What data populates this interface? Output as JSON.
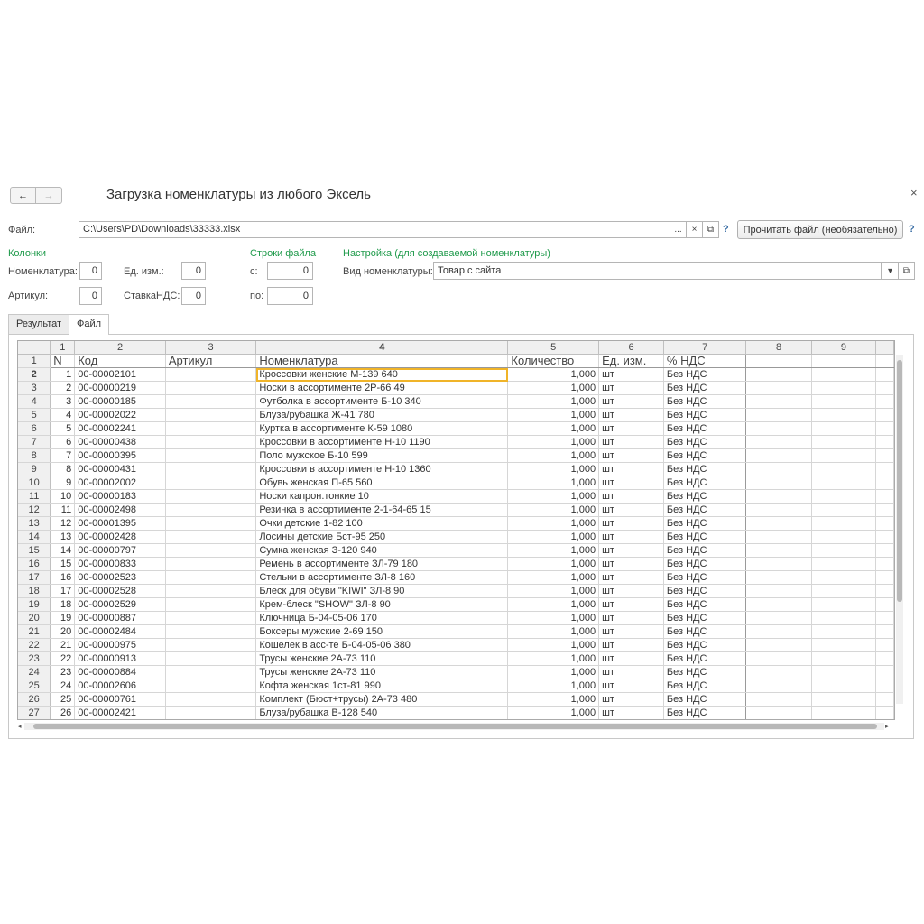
{
  "window": {
    "title": "Загрузка номенклатуры из любого Эксель",
    "back": "←",
    "forward": "→",
    "close": "×"
  },
  "file": {
    "label": "Файл:",
    "path": "C:\\Users\\PD\\Downloads\\33333.xlsx",
    "select_btn": "...",
    "clear_btn": "×",
    "open_btn": "⧉",
    "help": "?",
    "read_btn": "Прочитать файл (необязательно)",
    "read_help": "?"
  },
  "columns": {
    "section": "Колонки",
    "nomenclature_label": "Номенклатура:",
    "nomenclature_value": "0",
    "unit_label": "Ед. изм.:",
    "unit_value": "0",
    "article_label": "Артикул:",
    "article_value": "0",
    "vat_label": "СтавкаНДС:",
    "vat_value": "0"
  },
  "file_rows": {
    "section": "Строки файла",
    "from_label": "с:",
    "from_value": "0",
    "to_label": "по:",
    "to_value": "0"
  },
  "settings": {
    "section": "Настройка (для создаваемой номенклатуры)",
    "kind_label": "Вид номенклатуры:",
    "kind_value": "Товар с сайта",
    "dropdown": "▾",
    "open": "⧉"
  },
  "tabs": [
    {
      "label": "Результат"
    },
    {
      "label": "Файл"
    }
  ],
  "sheet": {
    "col_numbers": [
      "1",
      "2",
      "3",
      "4",
      "5",
      "6",
      "7",
      "8",
      "9"
    ],
    "headers": [
      "N",
      "Код",
      "Артикул",
      "Номенклатура",
      "Количество",
      "Ед. изм.",
      "% НДС",
      "",
      ""
    ],
    "rows": [
      [
        "1",
        "00-00002101",
        "",
        "Кроссовки женские М-139 640",
        "1,000",
        "шт",
        "Без НДС"
      ],
      [
        "2",
        "00-00000219",
        "",
        "Носки в ассортименте 2Р-66 49",
        "1,000",
        "шт",
        "Без НДС"
      ],
      [
        "3",
        "00-00000185",
        "",
        "Футболка в ассортименте Б-10 340",
        "1,000",
        "шт",
        "Без НДС"
      ],
      [
        "4",
        "00-00002022",
        "",
        "Блуза/рубашка Ж-41 780",
        "1,000",
        "шт",
        "Без НДС"
      ],
      [
        "5",
        "00-00002241",
        "",
        "Куртка в ассортименте К-59 1080",
        "1,000",
        "шт",
        "Без НДС"
      ],
      [
        "6",
        "00-00000438",
        "",
        "Кроссовки в ассортименте Н-10 1190",
        "1,000",
        "шт",
        "Без НДС"
      ],
      [
        "7",
        "00-00000395",
        "",
        "Поло мужское Б-10 599",
        "1,000",
        "шт",
        "Без НДС"
      ],
      [
        "8",
        "00-00000431",
        "",
        "Кроссовки в ассортименте Н-10 1360",
        "1,000",
        "шт",
        "Без НДС"
      ],
      [
        "9",
        "00-00002002",
        "",
        "Обувь женская П-65 560",
        "1,000",
        "шт",
        "Без НДС"
      ],
      [
        "10",
        "00-00000183",
        "",
        "Носки капрон.тонкие 10",
        "1,000",
        "шт",
        "Без НДС"
      ],
      [
        "11",
        "00-00002498",
        "",
        "Резинка в ассортименте 2-1-64-65 15",
        "1,000",
        "шт",
        "Без НДС"
      ],
      [
        "12",
        "00-00001395",
        "",
        "Очки детские 1-82 100",
        "1,000",
        "шт",
        "Без НДС"
      ],
      [
        "13",
        "00-00002428",
        "",
        "Лосины детские Бст-95 250",
        "1,000",
        "шт",
        "Без НДС"
      ],
      [
        "14",
        "00-00000797",
        "",
        "Сумка женская З-120 940",
        "1,000",
        "шт",
        "Без НДС"
      ],
      [
        "15",
        "00-00000833",
        "",
        "Ремень в ассортименте ЗЛ-79 180",
        "1,000",
        "шт",
        "Без НДС"
      ],
      [
        "16",
        "00-00002523",
        "",
        "Стельки в ассортименте ЗЛ-8 160",
        "1,000",
        "шт",
        "Без НДС"
      ],
      [
        "17",
        "00-00002528",
        "",
        "Блеск для обуви \"KIWI\" ЗЛ-8 90",
        "1,000",
        "шт",
        "Без НДС"
      ],
      [
        "18",
        "00-00002529",
        "",
        "Крем-блеск \"SHOW\" ЗЛ-8 90",
        "1,000",
        "шт",
        "Без НДС"
      ],
      [
        "19",
        "00-00000887",
        "",
        "Ключница Б-04-05-06 170",
        "1,000",
        "шт",
        "Без НДС"
      ],
      [
        "20",
        "00-00002484",
        "",
        "Боксеры мужские 2-69 150",
        "1,000",
        "шт",
        "Без НДС"
      ],
      [
        "21",
        "00-00000975",
        "",
        "Кошелек в асс-те Б-04-05-06 380",
        "1,000",
        "шт",
        "Без НДС"
      ],
      [
        "22",
        "00-00000913",
        "",
        "Трусы женские 2А-73 110",
        "1,000",
        "шт",
        "Без НДС"
      ],
      [
        "23",
        "00-00000884",
        "",
        "Трусы женские 2А-73 110",
        "1,000",
        "шт",
        "Без НДС"
      ],
      [
        "24",
        "00-00002606",
        "",
        "Кофта женская 1ст-81 990",
        "1,000",
        "шт",
        "Без НДС"
      ],
      [
        "25",
        "00-00000761",
        "",
        "Комплект (Бюст+трусы) 2А-73 480",
        "1,000",
        "шт",
        "Без НДС"
      ],
      [
        "26",
        "00-00002421",
        "",
        "Блуза/рубашка В-128 540",
        "1,000",
        "шт",
        "Без НДС"
      ]
    ]
  }
}
